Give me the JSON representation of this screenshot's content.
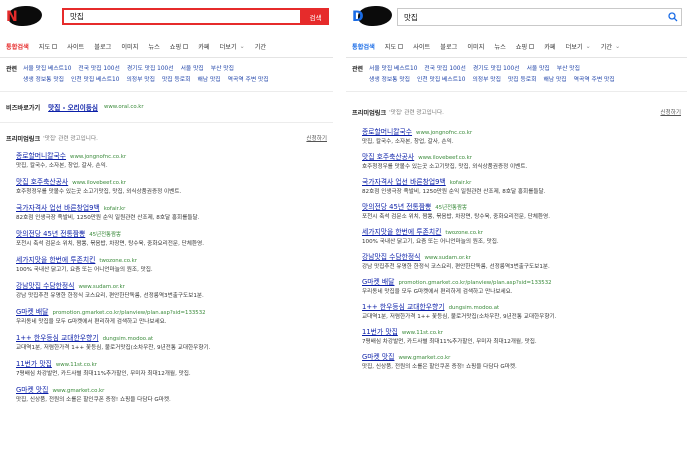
{
  "left": {
    "logo_letter": "N",
    "query": "맛집",
    "search_button": "검색",
    "tabs": [
      {
        "label": "통합검색",
        "active": true
      },
      {
        "label": "지도",
        "box": true
      },
      {
        "label": "사이트"
      },
      {
        "label": "블로그"
      },
      {
        "label": "이미지"
      },
      {
        "label": "뉴스"
      },
      {
        "label": "쇼핑",
        "box": true
      },
      {
        "label": "카페"
      },
      {
        "label": "더보기",
        "chevron": true
      },
      {
        "label": "기간"
      }
    ],
    "related": {
      "heading": "관련",
      "row1": [
        "서울 맛집 베스트10",
        "전국 맛집 100선",
        "경기도 맛집 100선",
        "서울 맛집",
        "부산 맛집"
      ],
      "row2": [
        "생생 정보통 맛집",
        "인천 맛집 베스트10",
        "의정부 맛집",
        "맛집 등로회",
        "해남 맛집",
        "역곡역 주변 맛집"
      ]
    },
    "biz": {
      "heading": "비즈바로가기",
      "link": "맛집 - 오리이등심",
      "url": "www.oral.co.kr"
    },
    "premium": {
      "title": "프리미엄링크",
      "subtitle": "'맛집' 관련 광고입니다.",
      "apply": "신청하기"
    },
    "ads": [
      {
        "title": "종로할머니칼국수",
        "url": "www.jongnofnc.co.kr",
        "desc": "맛집, 칼국수, 소자본, 창업, 갈사, 손익."
      },
      {
        "title": "맛집 호주축산공사",
        "url": "www.ilovebeef.co.kr",
        "desc": "호주청정우를 맛볼수 있는곳 소고기맛집, 맛집, 외식상품권증정 이벤트."
      },
      {
        "title": "국가자격사 업선 바른창업9백",
        "url": "kofair.kr",
        "desc": "82호점 인생극장 족발비, 1250만원 순익 일원관련 산조제, 8호달 홍회를들달."
      },
      {
        "title": "맛의전당 45년 전통짬뽕",
        "url": "45년전통짬뽕",
        "desc": "포천시 축석 검문소 위치, 짬뽕, 볶음밥, 차장면, 탕수육, 중화요리전문, 단체환영."
      },
      {
        "title": "세가지맛을 한번에 투존치킨",
        "url": "twozone.co.kr",
        "desc": "100% 국내산 닭고기, 요즘 또는 어니언마늘의 원조, 맛집."
      },
      {
        "title": "강남맛집 수담한정식",
        "url": "www.sudam.or.kr",
        "desc": "강남 맛집추천 유명한 한정식 코스요리, 편안한단독룸, 선정릉역3번출구도보1분."
      },
      {
        "title": "G마켓 배달",
        "url": "promotion.gmarket.co.kr/planview/plan.asp?sid=133532",
        "desc": "우리동네 맛집을 모두 G마켓에서 편리하게 검색하고 만나보세요."
      },
      {
        "title": "1++ 한우등심 교대한우향기",
        "url": "dungsim.modoo.at",
        "desc": "교대역1분, 저렴한가격 1++ 꽃등심, 불로거맛집(소차우찬, 9년전통 교대한우향기."
      },
      {
        "title": "11번가 맛집",
        "url": "www.11st.co.kr",
        "desc": "7평배심 차강발먼, 카드사별 최대11%추가할인, 무미자 최대12개월, 맛집."
      },
      {
        "title": "G마켓 맛집",
        "url": "www.gmarket.co.kr",
        "desc": "맛집, 신상품, 전원의 소를은 할인쿠폰 증정! 쇼핑을 다담다 G마켓."
      }
    ]
  },
  "right": {
    "logo_letter": "D",
    "query": "맛집",
    "tabs": [
      {
        "label": "통합검색",
        "active": true
      },
      {
        "label": "지도",
        "box": true
      },
      {
        "label": "사이트"
      },
      {
        "label": "블로그"
      },
      {
        "label": "이미지"
      },
      {
        "label": "뉴스"
      },
      {
        "label": "쇼핑",
        "box": true
      },
      {
        "label": "카페"
      },
      {
        "label": "더보기",
        "chevron": true
      },
      {
        "label": "기간",
        "chevron": true
      }
    ],
    "related": {
      "heading": "관련",
      "row1": [
        "서울 맛집 베스트10",
        "전국 맛집 100선",
        "경기도 맛집 100선",
        "서울 맛집",
        "부산 맛집"
      ],
      "row2": [
        "생생 정보통 맛집",
        "인천 맛집 베스트10",
        "의정부 맛집",
        "맛집 등로회",
        "해남 맛집",
        "역곡역 주변 맛집"
      ]
    },
    "premium": {
      "title": "프리미엄링크",
      "subtitle": "'맛집' 관련 광고입니다.",
      "apply": "신청하기"
    },
    "ads": [
      {
        "title": "종로할머니칼국수",
        "url": "www.jongnofnc.co.kr",
        "desc": "맛집, 칼국수, 소자본, 창업, 갈사, 손익."
      },
      {
        "title": "맛집 호주축산공사",
        "url": "www.ilovebeef.co.kr",
        "desc": "호주청정우를 맛볼수 있는곳 소고기맛집, 맛집, 외식상품권증정 이벤트."
      },
      {
        "title": "국가자격사 업선 바른창업9백",
        "url": "kofair.kr",
        "desc": "82호점 인생극장 족발비, 1250만원 순익 일원관련 산조제, 8호달 홍회를들달."
      },
      {
        "title": "맛의전당 45년 전통짬뽕",
        "url": "45년전통짬뽕",
        "desc": "포천시 축석 검문소 위치, 짬뽕, 볶음밥, 차장면, 탕수육, 중화요리전문, 단체환영."
      },
      {
        "title": "세가지맛을 한번에 투존치킨",
        "url": "twozone.co.kr",
        "desc": "100% 국내산 닭고기, 요즘 또는 어니언마늘의 원조, 맛집."
      },
      {
        "title": "강남맛집 수담한정식",
        "url": "www.sudam.or.kr",
        "desc": "강남 맛집추천 유명한 한정식 코스요리, 편안한단독룸, 선정릉역3번출구도보1분."
      },
      {
        "title": "G마켓 배달",
        "url": "promotion.gmarket.co.kr/planview/plan.asp?sid=133532",
        "desc": "우리동네 맛집을 모두 G마켓에서 편리하게 검색하고 만나보세요."
      },
      {
        "title": "1++ 한우등심 교대한우향기",
        "url": "dungsim.modoo.at",
        "desc": "교대역1분, 저렴한가격 1++ 꽃등심, 불로거맛집(소차우찬, 9년전통 교대한우향기."
      },
      {
        "title": "11번가 맛집",
        "url": "www.11st.co.kr",
        "desc": "7평배심 차강발먼, 카드사별 최대11%추가할인, 무미자 최대12개월, 맛집."
      },
      {
        "title": "G마켓 맛집",
        "url": "www.gmarket.co.kr",
        "desc": "맛집, 신상품, 전원의 소를은 할인쿠폰 증정! 쇼핑을 다담다 G마켓."
      }
    ]
  },
  "colors": {
    "left_accent": "#e62b2b",
    "right_accent": "#1a6ce6",
    "link": "#0b1fa8",
    "url": "#3a8a3a"
  }
}
